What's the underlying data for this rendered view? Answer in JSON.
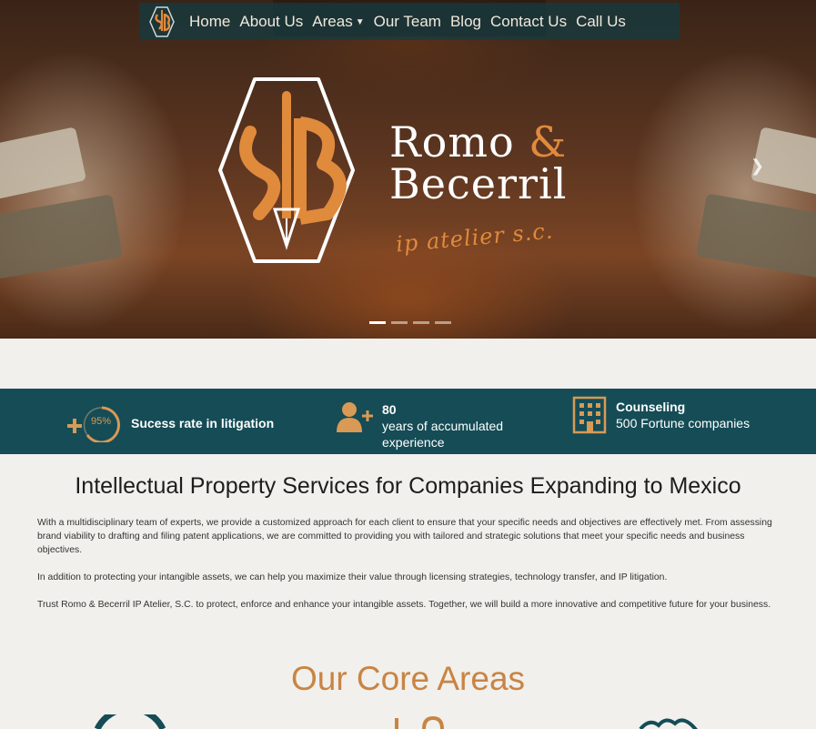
{
  "nav": {
    "items": [
      {
        "label": "Home"
      },
      {
        "label": "About Us"
      },
      {
        "label": "Areas"
      },
      {
        "label": "Our Team"
      },
      {
        "label": "Blog"
      },
      {
        "label": "Contact Us"
      },
      {
        "label": "Call Us"
      }
    ]
  },
  "hero": {
    "brand_line1": "Romo",
    "brand_amp": "&",
    "brand_line2": "Becerril",
    "tagline": "ip atelier s.c.",
    "slides": 4,
    "active_slide": 1
  },
  "stats": [
    {
      "icon": "plus-gauge-icon",
      "value": "95%",
      "label": "Sucess rate in litigation"
    },
    {
      "icon": "add-user-icon",
      "value": "80",
      "label": "years of accumulated experience"
    },
    {
      "icon": "building-icon",
      "value": "Counseling",
      "label": "500 Fortune companies"
    }
  ],
  "main": {
    "title": "Intellectual Property Services for Companies Expanding to Mexico",
    "paragraphs": [
      "With a multidisciplinary team of experts, we provide a customized approach for each client to ensure that your specific needs and objectives are effectively met. From assessing brand viability to drafting and filing patent applications, we are committed to providing you with tailored and strategic solutions that meet your specific needs and business objectives.",
      "In addition to protecting your intangible assets, we can help you maximize their value through licensing strategies, technology transfer, and IP litigation.",
      "Trust Romo & Becerril IP Atelier, S.C. to protect, enforce and enhance your intangible assets. Together, we will build a more innovative and competitive future for your business."
    ],
    "core_title": "Our Core Areas"
  },
  "colors": {
    "accent": "#c98443",
    "band": "#154c56",
    "nav_bg": "#123c42"
  }
}
